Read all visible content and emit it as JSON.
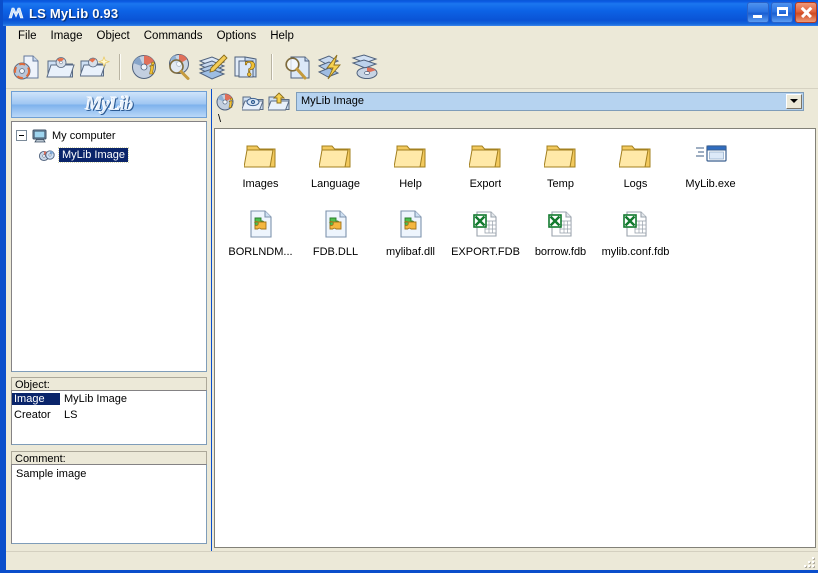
{
  "window": {
    "title": "LS MyLib 0.93",
    "app_icon": "mylib-logo-icon",
    "controls": {
      "minimize": "minimize-button",
      "maximize": "maximize-button",
      "close": "close-button"
    }
  },
  "menu": {
    "items": [
      {
        "label": "File"
      },
      {
        "label": "Image"
      },
      {
        "label": "Object"
      },
      {
        "label": "Commands"
      },
      {
        "label": "Options"
      },
      {
        "label": "Help"
      }
    ]
  },
  "toolbar": {
    "groups": [
      {
        "buttons": [
          {
            "icon": "new-image-disc-icon"
          },
          {
            "icon": "open-image-folder-icon"
          },
          {
            "icon": "new-folder-sparkle-icon"
          }
        ]
      },
      {
        "buttons": [
          {
            "icon": "disc-info-icon"
          },
          {
            "icon": "disc-search-icon"
          },
          {
            "icon": "edit-pages-pencil-icon"
          },
          {
            "icon": "pages-question-icon"
          }
        ]
      },
      {
        "buttons": [
          {
            "icon": "find-page-magnifier-icon"
          },
          {
            "icon": "flash-pages-icon"
          },
          {
            "icon": "pages-disc-icon"
          }
        ]
      }
    ]
  },
  "sidebar": {
    "logo": "MyLib",
    "tree": {
      "root": {
        "label": "My computer",
        "icon": "computer-icon",
        "expanded": true
      },
      "children": [
        {
          "label": "MyLib Image",
          "icon": "mylib-image-icon",
          "selected": true
        }
      ]
    },
    "object_panel": {
      "caption": "Object:",
      "rows": [
        {
          "key": "Image",
          "value": "MyLib Image",
          "selected": true
        },
        {
          "key": "Creator",
          "value": "LS",
          "selected": false
        }
      ]
    },
    "comment_panel": {
      "caption": "Comment:",
      "text": "Sample image"
    }
  },
  "content": {
    "address_buttons": [
      {
        "icon": "image-info-icon"
      },
      {
        "icon": "folder-view-icon"
      },
      {
        "icon": "folder-up-icon"
      }
    ],
    "combo": {
      "value": "MyLib Image",
      "arrow_icon": "chevron-down-icon"
    },
    "path": "\\",
    "items": [
      {
        "name": "Images",
        "icon": "folder-icon"
      },
      {
        "name": "Language",
        "icon": "folder-icon"
      },
      {
        "name": "Help",
        "icon": "folder-icon"
      },
      {
        "name": "Export",
        "icon": "folder-icon"
      },
      {
        "name": "Temp",
        "icon": "folder-icon"
      },
      {
        "name": "Logs",
        "icon": "folder-icon"
      },
      {
        "name": "MyLib.exe",
        "icon": "application-exe-icon"
      },
      {
        "name": "BORLNDM...",
        "icon": "dll-puzzle-icon"
      },
      {
        "name": "FDB.DLL",
        "icon": "dll-puzzle-icon"
      },
      {
        "name": "mylibaf.dll",
        "icon": "dll-puzzle-icon"
      },
      {
        "name": "EXPORT.FDB",
        "icon": "database-spreadsheet-icon"
      },
      {
        "name": "borrow.fdb",
        "icon": "database-spreadsheet-icon"
      },
      {
        "name": "mylib.conf.fdb",
        "icon": "database-spreadsheet-icon"
      }
    ]
  },
  "statusbar": {
    "text": "",
    "grip": "resize-grip-icon"
  },
  "colors": {
    "title_blue": "#0a57d8",
    "window_border": "#0a4ecb",
    "face": "#ece9d8",
    "tree_bg": "#a8caec",
    "selection": "#0a246a",
    "combo_bg": "#b6d3f0",
    "folder_yellow": "#f5d887"
  }
}
